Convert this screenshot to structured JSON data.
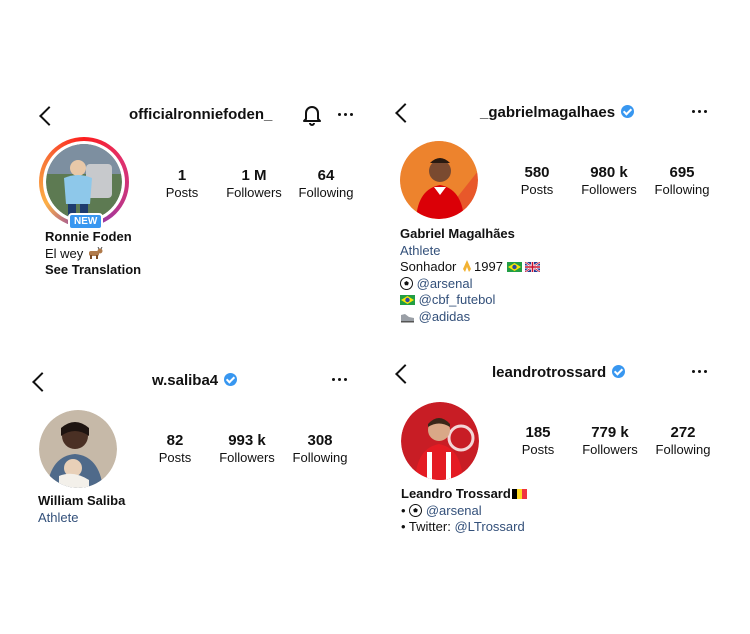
{
  "foden": {
    "handle": "officialronniefoden_",
    "badge": "NEW",
    "stats": [
      {
        "value": "1",
        "label": "Posts"
      },
      {
        "value": "1 M",
        "label": "Followers"
      },
      {
        "value": "64",
        "label": "Following"
      }
    ],
    "name": "Ronnie Foden",
    "bio_line": "El wey",
    "bio_emoji": "goat",
    "see_translation": "See Translation"
  },
  "gabriel": {
    "handle": "_gabrielmagalhaes",
    "verified": true,
    "stats": [
      {
        "value": "580",
        "label": "Posts"
      },
      {
        "value": "980 k",
        "label": "Followers"
      },
      {
        "value": "695",
        "label": "Following"
      }
    ],
    "name": "Gabriel Magalhães",
    "category": "Athlete",
    "bio_line_prefix": "Sonhador",
    "bio_line_year": "1997",
    "links": [
      {
        "icon": "soccer-ball",
        "text": "@arsenal"
      },
      {
        "icon": "brazil-flag",
        "text": "@cbf_futebol"
      },
      {
        "icon": "sneaker",
        "text": "@adidas"
      }
    ]
  },
  "saliba": {
    "handle": "w.saliba4",
    "verified": true,
    "stats": [
      {
        "value": "82",
        "label": "Posts"
      },
      {
        "value": "993 k",
        "label": "Followers"
      },
      {
        "value": "308",
        "label": "Following"
      }
    ],
    "name": "William Saliba",
    "category": "Athlete"
  },
  "trossard": {
    "handle": "leandrotrossard",
    "verified": true,
    "stats": [
      {
        "value": "185",
        "label": "Posts"
      },
      {
        "value": "779 k",
        "label": "Followers"
      },
      {
        "value": "272",
        "label": "Following"
      }
    ],
    "name": "Leandro Trossard",
    "bullets": [
      {
        "prefix": "•",
        "link": "@arsenal"
      },
      {
        "prefix": "• Twitter:",
        "link": "@LTrossard"
      }
    ]
  },
  "colors": {
    "link": "#33507a",
    "verified": "#3897f0",
    "arsenal_red": "#db0007"
  }
}
